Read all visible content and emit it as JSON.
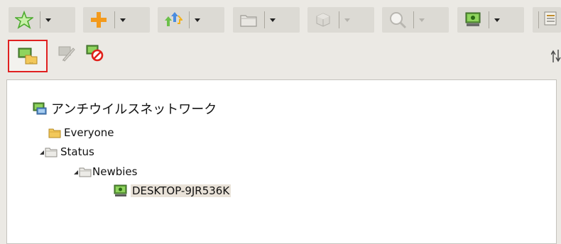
{
  "toolbar": {
    "groups": [
      {
        "icon": "star-icon",
        "dropdown": "enabled"
      },
      {
        "icon": "plus-icon",
        "dropdown": "enabled"
      },
      {
        "icon": "sync-arrows-icon",
        "dropdown": "enabled"
      },
      {
        "icon": "folder-icon",
        "dropdown": "enabled"
      },
      {
        "icon": "package-icon",
        "dropdown": "disabled"
      },
      {
        "icon": "search-icon",
        "dropdown": "disabled"
      },
      {
        "icon": "computer-icon",
        "dropdown": "enabled"
      },
      {
        "icon": "layout-icon",
        "dropdown": "partial"
      }
    ]
  },
  "subbar": {
    "buttons": [
      {
        "icon": "add-computer-to-group-icon",
        "selected": true
      },
      {
        "icon": "edit-computer-icon",
        "selected": false
      },
      {
        "icon": "remove-computer-icon",
        "selected": false
      }
    ],
    "sort_icon": "sort-arrows-icon"
  },
  "tree": {
    "root": {
      "label": "アンチウイルスネットワーク",
      "icon": "network-icon"
    },
    "items": [
      {
        "label": "Everyone",
        "icon": "folder-icon",
        "level": 1,
        "expanded": false
      },
      {
        "label": "Status",
        "icon": "folder-icon",
        "level": 1,
        "expanded": true
      },
      {
        "label": "Newbies",
        "icon": "folder-icon",
        "level": 2,
        "expanded": true
      },
      {
        "label": "DESKTOP-9JR536K",
        "icon": "computer-icon",
        "level": 3,
        "selected": true
      }
    ]
  },
  "colors": {
    "selection_outline": "#e02020",
    "selection_bg": "#e9e2d8",
    "toolbar_bg": "#dcdad4",
    "window_bg": "#ebe9e4"
  }
}
